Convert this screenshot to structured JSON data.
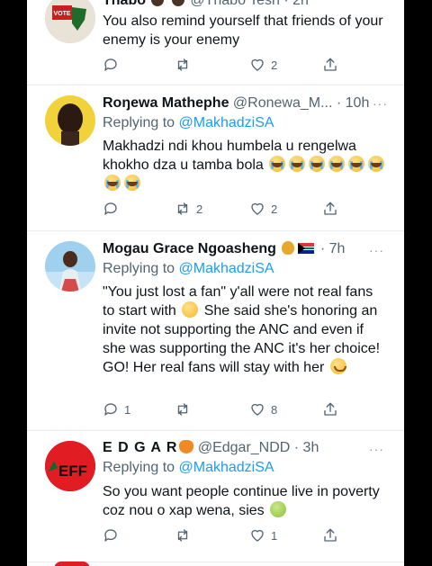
{
  "tweets": [
    {
      "name": "Thabo",
      "handle_time": "@Thabo Tesh · 2h",
      "body": "You also remind yourself that friends of your enemy is your enemy",
      "replies": "",
      "retweets": "",
      "likes": "2",
      "avatar_label": "VOTE"
    },
    {
      "name": "Roŋewa Mathephe",
      "handle_time": "@Ronewa_M... · 10h",
      "replying_prefix": "Replying to ",
      "replying_handle": "@MakhadziSA",
      "body": "Makhadzi ndi khou humbela u rengelwa khokho dza u tamba bola",
      "emoji_count": 8,
      "replies": "",
      "retweets": "2",
      "likes": "2"
    },
    {
      "name": "Mogau Grace Ngoasheng",
      "handle_time": "· 7h",
      "replying_prefix": "Replying to ",
      "replying_handle": "@MakhadziSA",
      "body_part1": "\"You just lost a fan\" y'all were not real fans to start with",
      "body_part2": "She said she's honoring an invite not supporting the ANC and even if she was supporting the ANC it's her choice! GO! Her real fans will stay with her",
      "replies": "1",
      "retweets": "",
      "likes": "8"
    },
    {
      "name": "E D G A R",
      "handle_time": "@Edgar_NDD · 3h",
      "replying_prefix": "Replying to ",
      "replying_handle": "@MakhadziSA",
      "body": "So you want people continue live in poverty coz nou o xap wena, sies",
      "replies": "",
      "retweets": "",
      "likes": "1",
      "avatar_label": "EFF"
    }
  ],
  "more_label": "···",
  "colors": {
    "link": "#1d9bf0",
    "text": "#0f1419",
    "muted": "#536471"
  }
}
